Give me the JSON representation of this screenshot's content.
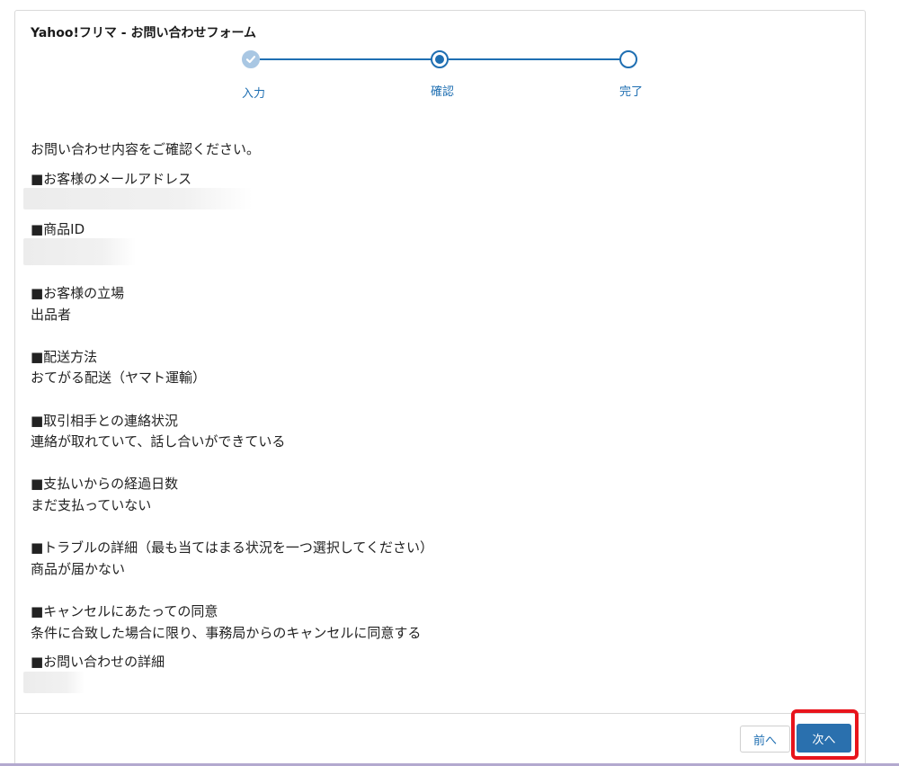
{
  "form": {
    "title": "Yahoo!フリマ - お問い合わせフォーム",
    "intro": "お問い合わせ内容をご確認ください。"
  },
  "stepper": {
    "steps": [
      {
        "label": "入力",
        "state": "done"
      },
      {
        "label": "確認",
        "state": "current"
      },
      {
        "label": "完了",
        "state": "todo"
      }
    ],
    "accent_color": "#1f6fb2",
    "done_color": "#a9c7e3"
  },
  "fields": [
    {
      "label": "■お客様のメールアドレス",
      "value": ""
    },
    {
      "label": "■商品ID",
      "value": ""
    },
    {
      "label": "■お客様の立場",
      "value": "出品者"
    },
    {
      "label": "■配送方法",
      "value": "おてがる配送（ヤマト運輸）"
    },
    {
      "label": "■取引相手との連絡状況",
      "value": "連絡が取れていて、話し合いができている"
    },
    {
      "label": "■支払いからの経過日数",
      "value": "まだ支払っていない"
    },
    {
      "label": "■トラブルの詳細（最も当てはまる状況を一つ選択してください）",
      "value": "商品が届かない"
    },
    {
      "label": "■キャンセルにあたっての同意",
      "value": "条件に合致した場合に限り、事務局からのキャンセルに同意する"
    },
    {
      "label": "■お問い合わせの詳細",
      "value": ""
    }
  ],
  "footer": {
    "prev_label": "前へ",
    "next_label": "次へ",
    "next_color": "#2a70ae",
    "highlight_color": "#e8141c"
  }
}
